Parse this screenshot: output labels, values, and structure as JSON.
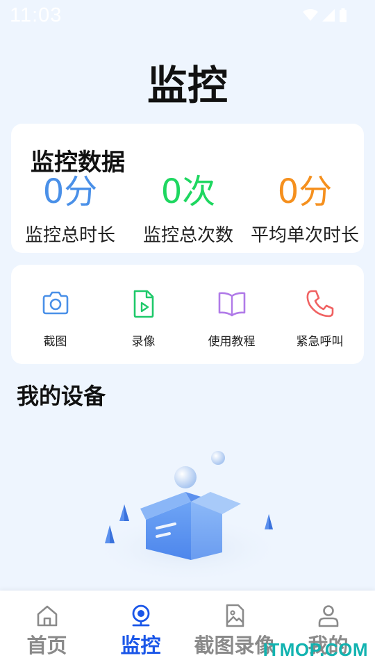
{
  "status_bar": {
    "time": "11:03",
    "icons": [
      "wifi-icon",
      "signal-icon",
      "battery-icon"
    ]
  },
  "page": {
    "title": "监控"
  },
  "stats": {
    "title": "监控数据",
    "items": [
      {
        "value": "0分",
        "label": "监控总时长",
        "color": "#4a90e8"
      },
      {
        "value": "0次",
        "label": "监控总次数",
        "color": "#1ed760"
      },
      {
        "value": "0分",
        "label": "平均单次时长",
        "color": "#f5901e"
      }
    ]
  },
  "actions": [
    {
      "label": "截图",
      "icon": "camera-icon",
      "color": "#4a90e8"
    },
    {
      "label": "录像",
      "icon": "video-file-icon",
      "color": "#1ec96a"
    },
    {
      "label": "使用教程",
      "icon": "book-icon",
      "color": "#b07ae8"
    },
    {
      "label": "紧急呼叫",
      "icon": "phone-icon",
      "color": "#f06262"
    }
  ],
  "devices": {
    "title": "我的设备",
    "empty_illustration": "empty-box-icon"
  },
  "bottom_nav": {
    "active": 1,
    "active_color": "#1a56e8",
    "inactive_color": "#8a8a8a",
    "items": [
      {
        "label": "首页",
        "icon": "home-icon"
      },
      {
        "label": "监控",
        "icon": "webcam-icon"
      },
      {
        "label": "截图录像",
        "icon": "image-file-icon"
      },
      {
        "label": "我的",
        "icon": "user-icon"
      }
    ]
  },
  "watermark": "ITMOP.COM"
}
